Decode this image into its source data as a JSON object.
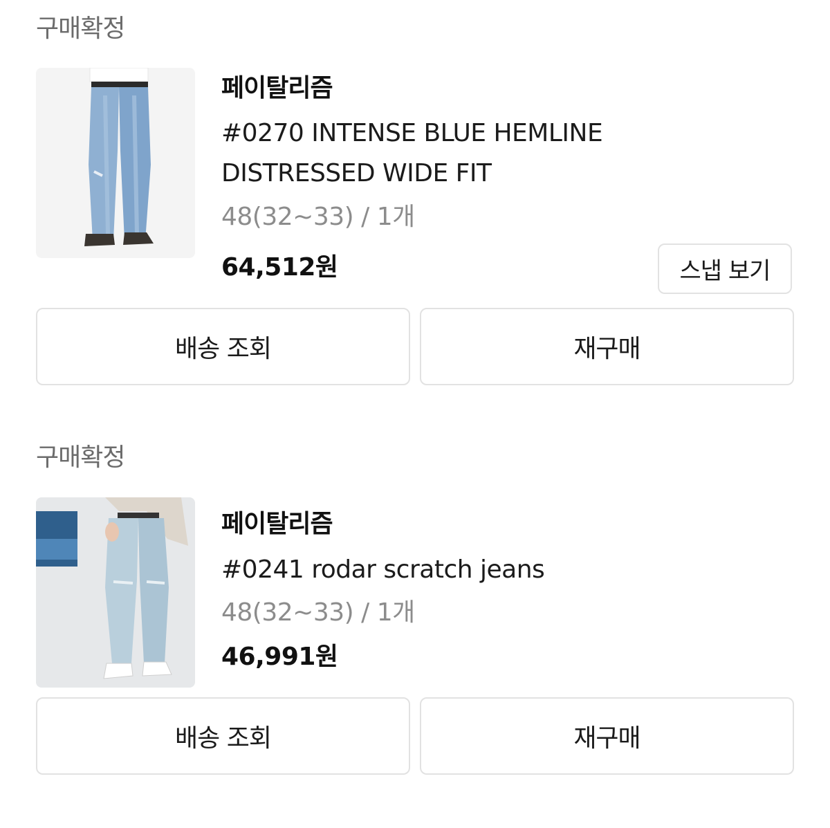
{
  "orders": [
    {
      "status": "구매확정",
      "brand": "페이탈리즘",
      "product_name": "#0270 INTENSE BLUE HEMLINE DISTRESSED WIDE FIT",
      "option": "48(32~33) / 1개",
      "price": "64,512원",
      "snap_label": "스냅 보기",
      "tracking_label": "배송 조회",
      "rebuy_label": "재구매",
      "thumbnail_icon": "wide-fit-denim-photo"
    },
    {
      "status": "구매확정",
      "brand": "페이탈리즘",
      "product_name": "#0241 rodar scratch jeans",
      "option": "48(32~33) / 1개",
      "price": "46,991원",
      "tracking_label": "배송 조회",
      "rebuy_label": "재구매",
      "thumbnail_icon": "light-wash-denim-photo"
    }
  ],
  "colors": {
    "status_text": "#6b6b6b",
    "option_text": "#8c8c8c",
    "button_border": "#e2e2e2",
    "text_primary": "#111111"
  }
}
